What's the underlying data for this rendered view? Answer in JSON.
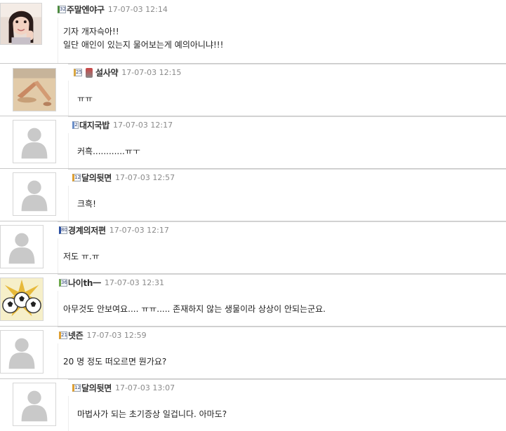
{
  "comments": [
    {
      "avatar": "photo-woman-avatar",
      "level": "32",
      "level_color": "#4d8b3f",
      "nickname": "주말엔야구",
      "time": "17-07-03 12:14",
      "lines": [
        "기자 개자슥아!!",
        "일단 애인이 있는지 물어보는게 예의아니냐!!!"
      ]
    },
    {
      "avatar": "photo-beach-avatar",
      "level": "25",
      "level_color": "#d9a640",
      "nickname": "설사약",
      "time": "17-07-03 12:15",
      "has_badge": true,
      "lines": [
        "ㅠㅠ"
      ]
    },
    {
      "avatar": "default-user-avatar",
      "level": "2",
      "level_color": "#6b8fc9",
      "nickname": "대지국밥",
      "time": "17-07-03 12:17",
      "lines": [
        "커흑............ㅠㅜ"
      ]
    },
    {
      "avatar": "default-user-avatar",
      "level": "12",
      "level_color": "#e0a030",
      "nickname": "달의뒷면",
      "time": "17-07-03 12:57",
      "lines": [
        "크흑!"
      ]
    },
    {
      "avatar": "default-user-avatar",
      "level": "80",
      "level_color": "#2a4fa3",
      "nickname": "경계의저편",
      "time": "17-07-03 12:17",
      "lines": [
        "저도 ㅠ.ㅠ"
      ]
    },
    {
      "avatar": "soccer-balls-avatar",
      "level": "36",
      "level_color": "#6da84a",
      "nickname": "나이th一",
      "time": "17-07-03 12:31",
      "lines": [
        "아무것도 안보여요.... ㅠㅠ..... 존재하지 않는 생물이라 상상이 안되는군요."
      ]
    },
    {
      "avatar": "default-user-avatar",
      "level": "21",
      "level_color": "#e0a030",
      "nickname": "넷즌",
      "time": "17-07-03 12:59",
      "lines": [
        "20 명 정도 떠오르면 뭔가요?"
      ]
    },
    {
      "avatar": "default-user-avatar",
      "level": "12",
      "level_color": "#e0a030",
      "nickname": "달의뒷면",
      "time": "17-07-03 13:07",
      "lines": [
        "마법사가 되는 초기증상 일겁니다. 아마도?"
      ]
    }
  ]
}
